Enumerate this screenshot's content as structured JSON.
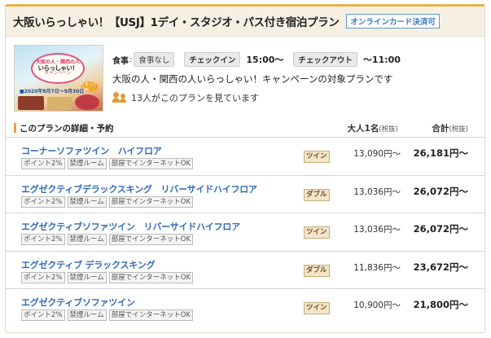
{
  "plan": {
    "title": "大阪いらっしゃい！【USJ】1デイ・スタジオ・パス付き宿泊プラン",
    "card_badge": "オンラインカード決済可",
    "thumbnail": {
      "line1": "大阪の人・関西の人",
      "line2": "いらっしゃい！",
      "line3": "キャンペーン",
      "date": "■2020年8月7日〜9月30日",
      "tag": "ぐるっと関西"
    },
    "meal_label": "食事",
    "meal_value": "食事なし",
    "checkin_label": "チェックイン",
    "checkin_time": "15:00〜",
    "checkout_label": "チェックアウト",
    "checkout_time": "〜11:00",
    "description": "大阪の人・関西の人いらっしゃい！キャンペーンの対象プランです",
    "watching": "13人がこのプランを見ています"
  },
  "details": {
    "title": "このプランの詳細・予約",
    "adult_header": "大人1名",
    "total_header": "合計",
    "tax_note": "(税抜)"
  },
  "rooms": [
    {
      "name": "コーナーソファツイン　ハイフロア",
      "type": "ツイン",
      "adult_price": "13,090円〜",
      "total_price": "26,181円〜",
      "tags": [
        "ポイント2%",
        "禁煙ルーム",
        "部屋でインターネットOK"
      ]
    },
    {
      "name": "エグゼクティブデラックスキング　リバーサイドハイフロア",
      "type": "ダブル",
      "adult_price": "13,036円〜",
      "total_price": "26,072円〜",
      "tags": [
        "ポイント2%",
        "禁煙ルーム",
        "部屋でインターネットOK"
      ]
    },
    {
      "name": "エグゼクティブソファツイン　リバーサイドハイフロア",
      "type": "ツイン",
      "adult_price": "13,036円〜",
      "total_price": "26,072円〜",
      "tags": [
        "ポイント2%",
        "禁煙ルーム",
        "部屋でインターネットOK"
      ]
    },
    {
      "name": "エグゼクティブ デラックスキング",
      "type": "ダブル",
      "adult_price": "11,836円〜",
      "total_price": "23,672円〜",
      "tags": [
        "ポイント2%",
        "禁煙ルーム",
        "部屋でインターネットOK"
      ]
    },
    {
      "name": "エグゼクティブソファツイン",
      "type": "ツイン",
      "adult_price": "10,900円〜",
      "total_price": "21,800円〜",
      "tags": [
        "ポイント2%",
        "禁煙ルーム",
        "部屋でインターネットOK"
      ]
    }
  ],
  "colors": {
    "accent": "#e7a33b",
    "link": "#2f6bb8",
    "header_bg": "#f6f0e3"
  }
}
